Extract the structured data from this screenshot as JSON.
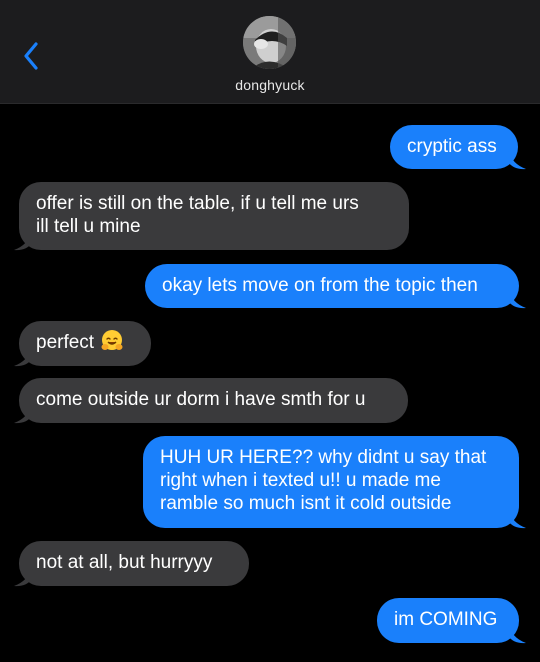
{
  "header": {
    "contact_name": "donghyuck",
    "back_icon": "chevron-left-icon"
  },
  "colors": {
    "outgoing_bubble": "#1a80fb",
    "incoming_bubble": "#3a3a3c",
    "accent": "#1a80fb",
    "background": "#000000",
    "header_bg": "#1c1c1e"
  },
  "messages": [
    {
      "direction": "outgoing",
      "lines": [
        "cryptic ass"
      ]
    },
    {
      "direction": "incoming",
      "lines": [
        "offer is still on the table, if u tell me urs",
        "ill tell u mine"
      ]
    },
    {
      "direction": "outgoing",
      "lines": [
        "okay lets move on from the topic then"
      ]
    },
    {
      "direction": "incoming",
      "lines": [
        "perfect"
      ],
      "emoji": "hugging-face-emoji"
    },
    {
      "direction": "incoming",
      "lines": [
        "come outside ur dorm i have smth for u"
      ]
    },
    {
      "direction": "outgoing",
      "lines": [
        "HUH UR HERE?? why didnt u say that",
        "right when i texted u!! u made me",
        "ramble so much isnt it cold outside"
      ]
    },
    {
      "direction": "incoming",
      "lines": [
        "not at all, but hurryyy"
      ]
    },
    {
      "direction": "outgoing",
      "lines": [
        "im COMING"
      ]
    }
  ]
}
